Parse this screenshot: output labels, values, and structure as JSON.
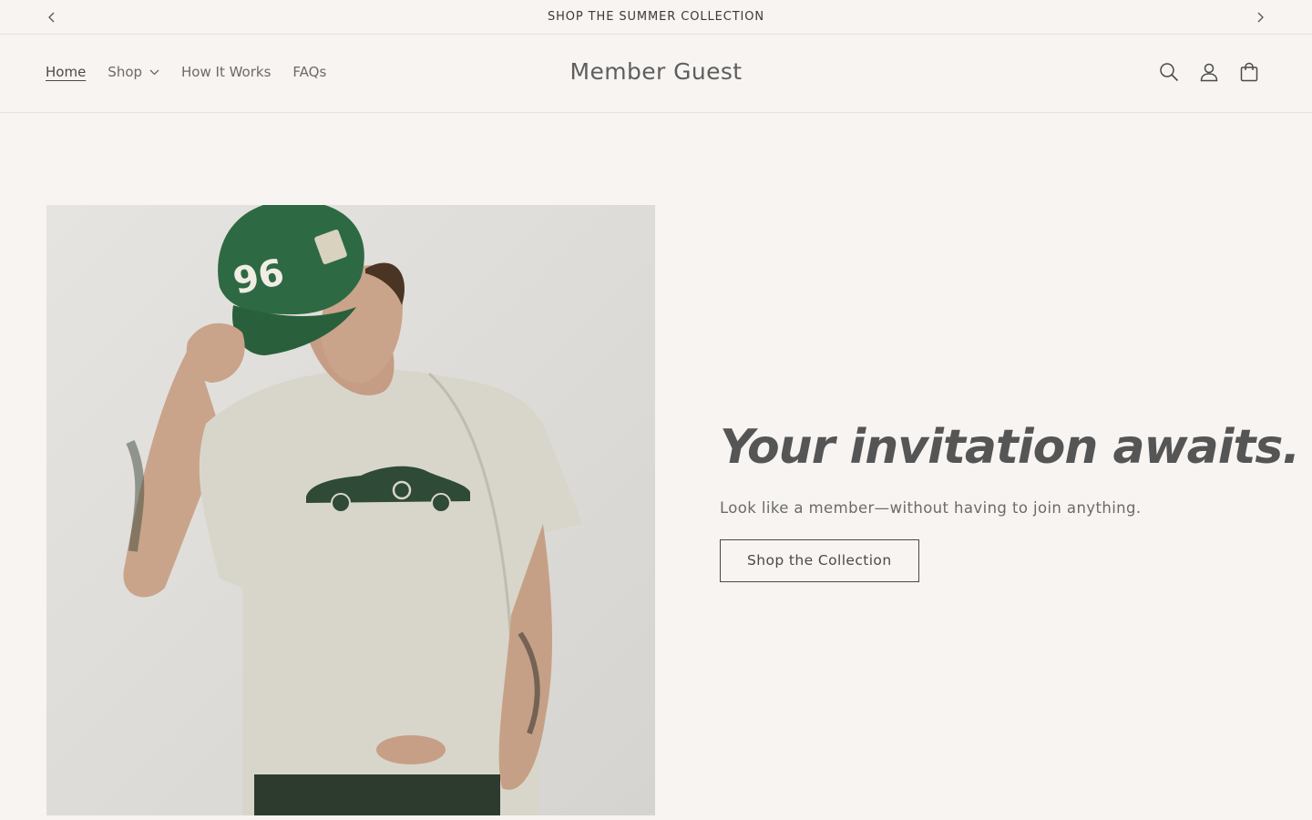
{
  "announcement": {
    "text": "SHOP THE SUMMER COLLECTION",
    "prev_icon": "chevron-left-icon",
    "next_icon": "chevron-right-icon"
  },
  "header": {
    "brand": "Member Guest",
    "nav": [
      {
        "label": "Home",
        "active": true
      },
      {
        "label": "Shop",
        "has_dropdown": true
      },
      {
        "label": "How It Works"
      },
      {
        "label": "FAQs"
      }
    ],
    "icons": [
      "search-icon",
      "account-icon",
      "cart-icon"
    ]
  },
  "hero": {
    "title": "Your invitation awaits.",
    "subtitle": "Look like a member—without having to join anything.",
    "button_label": "Shop the Collection",
    "image": {
      "shirt_color": "#d8d6cb",
      "cap_color": "#2d6a43",
      "cap_number": "96"
    }
  },
  "colors": {
    "background": "#f7f4f1",
    "text": "#4a4a4a",
    "accent_green": "#2d6a43"
  }
}
